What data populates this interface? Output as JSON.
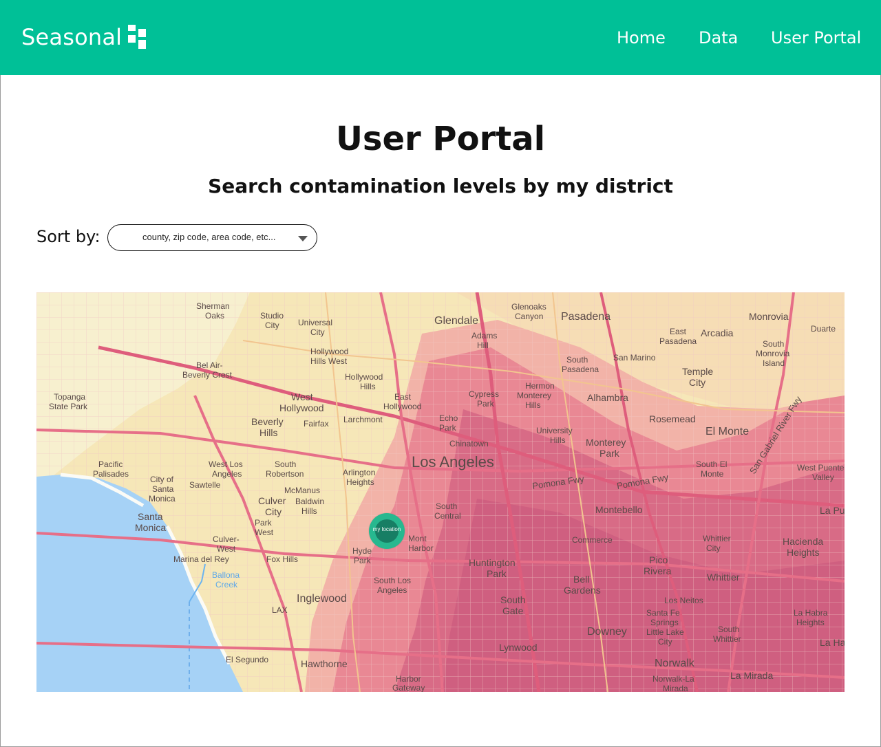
{
  "header": {
    "brand": "Seasonal",
    "nav": [
      "Home",
      "Data",
      "User Portal"
    ]
  },
  "main": {
    "title": "User Portal",
    "subtitle": "Search contamination levels by my district",
    "sort_label": "Sort by:",
    "select_placeholder": "county, zip code, area code, etc..."
  },
  "map": {
    "pin_label": "my location",
    "places": [
      "Sherman Oaks",
      "Studio City",
      "Universal City",
      "Glendale",
      "Glenoaks Canyon",
      "Adams Hill",
      "Pasadena",
      "Monrovia",
      "Duarte",
      "East Pasadena",
      "Arcadia",
      "South Monrovia Island",
      "Bel Air-Beverly Crest",
      "Hollywood Hills West",
      "Hollywood Hills",
      "South Pasadena",
      "San Marino",
      "Temple City",
      "Topanga State Park",
      "West Hollywood",
      "East Hollywood",
      "Cypress Park",
      "Hermon",
      "Monterey Hills",
      "Alhambra",
      "Beverly Hills",
      "Fairfax",
      "Larchmont",
      "Echo Park",
      "Rosemead",
      "El Monte",
      "Chinatown",
      "University Hills",
      "Monterey Park",
      "Los Angeles",
      "Pacific Palisades",
      "West Los Angeles",
      "South Robertson",
      "Arlington Heights",
      "South El Monte",
      "West Puente Valley",
      "City of Santa Monica",
      "Sawtelle",
      "McManus",
      "Culver City",
      "Baldwin Hills",
      "South Central",
      "Montebello",
      "La Puente",
      "Santa Monica",
      "Park West",
      "Culver-West",
      "Commerce",
      "Whittier City",
      "Hacienda Heights",
      "Marina del Rey",
      "Fox Hills",
      "Hyde Park",
      "Mont Harbor",
      "Huntington Park",
      "Pico Rivera",
      "Whittier",
      "Ballona Creek",
      "South Los Angeles",
      "Bell Gardens",
      "Inglewood",
      "South Gate",
      "Los Neitos",
      "LAX",
      "Santa Fe Springs",
      "Little Lake City",
      "Downey",
      "South Whittier",
      "La Habra Heights",
      "La Ha",
      "Lynwood",
      "El Segundo",
      "Hawthorne",
      "Norwalk",
      "Norwalk-La Mirada",
      "La Mirada",
      "Harbor Gateway",
      "Pomona Fwy",
      "San Gabriel River Fwy"
    ]
  },
  "colors": {
    "brand": "#00c097",
    "water": "#a6d2f6",
    "pin": "#27b88f"
  }
}
